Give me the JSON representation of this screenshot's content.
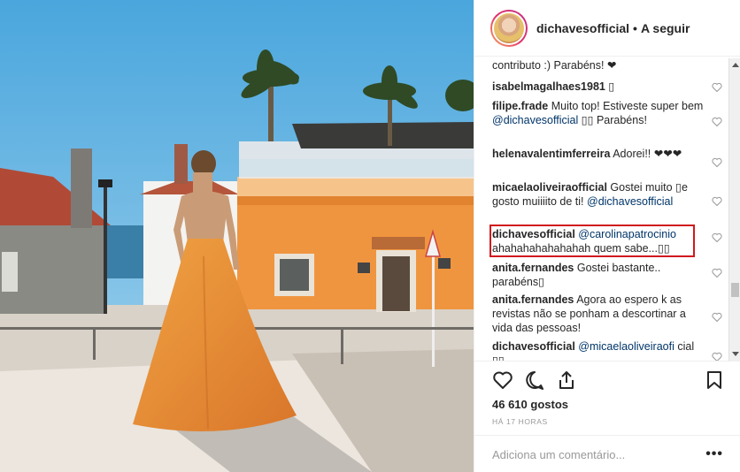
{
  "header": {
    "username": "dichavesofficial",
    "separator": "•",
    "follow_label": "A seguir"
  },
  "comments": [
    {
      "user": "",
      "text": "contributo :) Parabéns! ❤"
    },
    {
      "user": "isabelmagalhaes1981",
      "text": "▯"
    },
    {
      "user": "filipe.frade",
      "text": "Muito top! Estiveste super bem",
      "mention": "@dichavesofficial",
      "text2": "▯▯ Parabéns!"
    },
    {
      "user": "helenavalentimferreira",
      "text": "Adorei!! ❤❤❤"
    },
    {
      "user": "micaelaoliveiraofficial",
      "text": "Gostei muito ▯e gosto muiiiito de ti!",
      "mention": "@dichavesofficial",
      "text2": ""
    },
    {
      "user": "dichavesofficial",
      "text": "",
      "mention": "@carolinapatrocinio",
      "text2": "ahahahahahahahah quem sabe...▯▯"
    },
    {
      "user": "anita.fernandes",
      "text": "Gostei bastante.. parabéns▯"
    },
    {
      "user": "anita.fernandes",
      "text": "Agora ao espero k as revistas não se ponham a descortinar a vida das pessoas!"
    },
    {
      "user": "dichavesofficial",
      "text": "",
      "mention": "@micaelaoliveiraofi",
      "text2": "cial ▯▯"
    }
  ],
  "likes_text": "46 610 gostos",
  "time_text": "HÁ 17 HORAS",
  "add_comment_placeholder": "Adiciona um comentário...",
  "more_label": "•••",
  "icons": {
    "like": "heart-icon",
    "comment": "comment-icon",
    "share": "share-icon",
    "save": "bookmark-icon"
  },
  "colors": {
    "highlight": "#d0191e",
    "mention": "#003569",
    "dress": "#e8912e",
    "building": "#f0953f"
  }
}
